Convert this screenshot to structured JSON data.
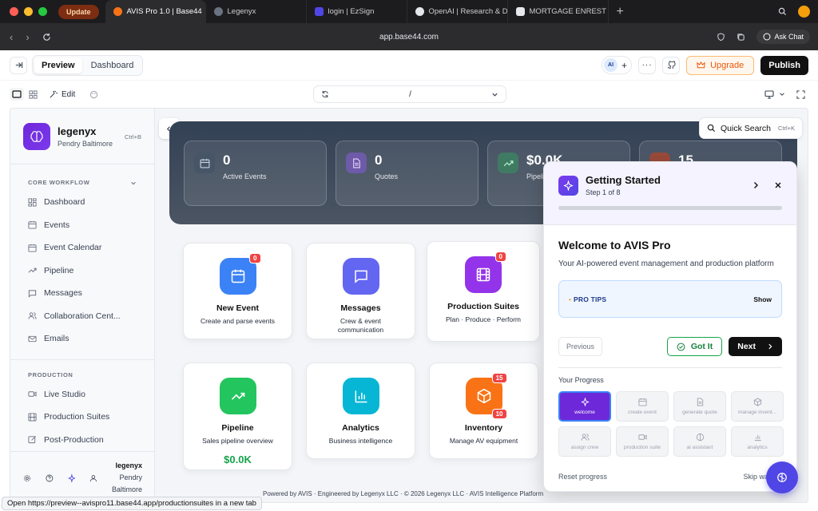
{
  "browser": {
    "update_label": "Update",
    "tabs": [
      {
        "label": "AVIS Pro 1.0 | Base44",
        "fav_color": "#f97316",
        "active": true
      },
      {
        "label": "Legenyx",
        "fav_color": "#6b7280",
        "active": false
      },
      {
        "label": "login | EzSign",
        "fav_color": "#4f46e5",
        "active": false
      },
      {
        "label": "OpenAI | Research & D",
        "fav_color": "#e5e7eb",
        "active": false
      },
      {
        "label": "MORTGAGE ENREST -",
        "fav_color": "#e5e7eb",
        "active": false
      }
    ],
    "url": "app.base44.com",
    "ask_chat": "Ask Chat"
  },
  "app_header": {
    "modes": [
      "Preview",
      "Dashboard"
    ],
    "ai_label": "AI",
    "upgrade_label": "Upgrade",
    "publish_label": "Publish",
    "edit_label": "Edit",
    "route": "/"
  },
  "sidebar": {
    "brand_name": "legenyx",
    "brand_sub": "Pendry Baltimore",
    "shortcut": "Ctrl+B",
    "sections": [
      {
        "title": "CORE WORKFLOW",
        "items": [
          "Dashboard",
          "Events",
          "Event Calendar",
          "Pipeline",
          "Messages",
          "Collaboration Cent...",
          "Emails"
        ]
      },
      {
        "title": "PRODUCTION",
        "items": [
          "Live Studio",
          "Production Suites",
          "Post-Production"
        ]
      }
    ],
    "user_name": "legenyx",
    "user_sub1": "Pendry",
    "user_sub2": "Baltimore"
  },
  "stats": [
    {
      "value": "0",
      "label": "Active Events"
    },
    {
      "value": "0",
      "label": "Quotes"
    },
    {
      "value": "$0.0K",
      "label": "Pipeline"
    },
    {
      "value": "15",
      "label": ""
    }
  ],
  "quick_search": {
    "label": "Quick Search",
    "shortcut": "Ctrl+K"
  },
  "cards": [
    {
      "title": "New Event",
      "desc": "Create and parse events",
      "badge": "0"
    },
    {
      "title": "Messages",
      "desc": "Crew & event communication",
      "badge": ""
    },
    {
      "title": "Production Suites",
      "desc": "Plan · Produce · Perform",
      "badge": "0"
    },
    {
      "title": "Pipeline",
      "desc": "Sales pipeline overview",
      "amount": "$0.0K"
    },
    {
      "title": "Analytics",
      "desc": "Business intelligence"
    },
    {
      "title": "Inventory",
      "desc": "Manage AV equipment",
      "badge": "15",
      "badge2": "10"
    }
  ],
  "footer_text": "Powered by AVIS · Engineered by Legenyx LLC · © 2026 Legenyx LLC · AVIS Intelligence Platform",
  "getting_started": {
    "title": "Getting Started",
    "step": "Step 1 of 8",
    "progress": 0.0,
    "welcome_title": "Welcome to AVIS Pro",
    "welcome_sub": "Your AI-powered event management and production platform",
    "tips_label": "PRO TIPS",
    "tips_show": "Show",
    "prev_label": "Previous",
    "gotit_label": "Got It",
    "next_label": "Next",
    "progress_label": "Your Progress",
    "steps": [
      "welcome",
      "create event",
      "generate quote",
      "manage invent...",
      "assign crew",
      "production suite",
      "ai assistant",
      "analytics"
    ],
    "reset_label": "Reset progress",
    "skip_label": "Skip walkthr"
  },
  "status_bar": {
    "prefix": "Open",
    "url": "https://preview--avispro11.base44.app/productionsuites in a new tab"
  }
}
